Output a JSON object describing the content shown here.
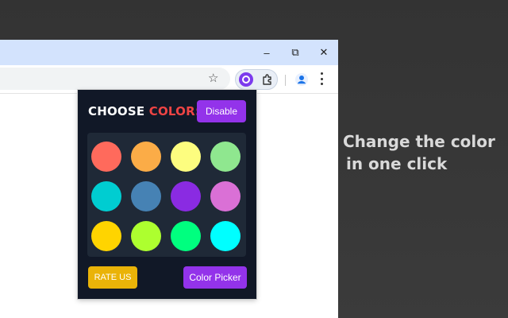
{
  "browser": {
    "window_controls": {
      "minimize": "–",
      "restore": "⧉",
      "close": "✕"
    },
    "toolbar": {
      "bookmark_star": "☆"
    }
  },
  "popup": {
    "title_main": "CHOOSE ",
    "title_accent": "COLOR:",
    "disable_label": "Disable",
    "rate_label": "RATE US",
    "picker_label": "Color Picker",
    "swatches": [
      "#ff6a5c",
      "#fbac47",
      "#fdfd7f",
      "#8fe78f",
      "#00cdd1",
      "#4682b4",
      "#8a2be2",
      "#da70d6",
      "#ffd400",
      "#adff2f",
      "#00ff7f",
      "#00ffff"
    ],
    "colors": {
      "accent": "#9333ea",
      "title_accent": "#ef4444",
      "rate": "#eab308",
      "panel": "#111827"
    }
  },
  "tagline": {
    "line1": "Change the color",
    "line2": "in one click"
  }
}
